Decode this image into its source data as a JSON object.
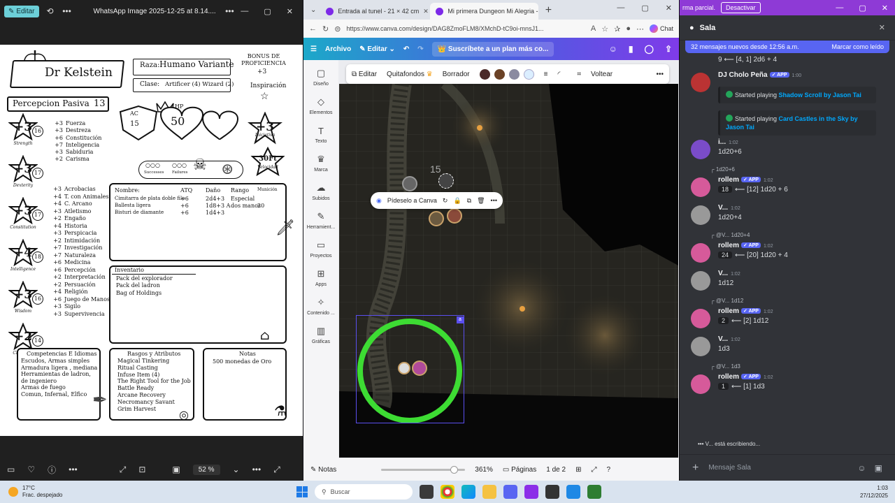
{
  "photos": {
    "edit_label": "Editar",
    "file_title": "WhatsApp Image 2025-12-25 at 8.14....",
    "zoom": "52 %"
  },
  "sheet": {
    "name": "Dr Kelstein",
    "raza_label": "Raza:",
    "raza": "Humano Variante",
    "clase_label": "Clase:",
    "clase": "Artificer (4) Wizard (2)",
    "bonus_label": "BONUS DE PROFICIENCIA",
    "bonus": "+3",
    "inspiracion": "Inspiración",
    "percepcion_label": "Percepcion Pasiva",
    "percepcion": "13",
    "ac_label": "AC",
    "ac": "15",
    "hp_label": "HP",
    "hp": "50",
    "iniciativa": "+3",
    "iniciativa_label": "Iniciativa",
    "velocidad": "30Ft",
    "velocidad_label": "Velocidad",
    "successes": "Successes",
    "failures": "Failures",
    "stats": [
      {
        "mod": "+3",
        "score": "16",
        "label": "Strength"
      },
      {
        "mod": "+3",
        "score": "17",
        "label": "Dexterity"
      },
      {
        "mod": "+3",
        "score": "17",
        "label": "Constitution"
      },
      {
        "mod": "+4",
        "score": "18",
        "label": "Intelligence"
      },
      {
        "mod": "+3",
        "score": "16",
        "label": "Wisdom"
      },
      {
        "mod": "+2",
        "score": "14",
        "label": "Charisma"
      }
    ],
    "saves": [
      {
        "b": "+3",
        "n": "Fuerza"
      },
      {
        "b": "+3",
        "n": "Destreza"
      },
      {
        "b": "+6",
        "n": "Constitución"
      },
      {
        "b": "+7",
        "n": "Inteligencia"
      },
      {
        "b": "+3",
        "n": "Sabiduria"
      },
      {
        "b": "+2",
        "n": "Carisma"
      }
    ],
    "skills": [
      {
        "b": "+3",
        "n": "Acrobacias"
      },
      {
        "b": "+4",
        "n": "T. con Animales"
      },
      {
        "b": "+4",
        "n": "C. Arcano"
      },
      {
        "b": "+3",
        "n": "Atletismo"
      },
      {
        "b": "+2",
        "n": "Engaño"
      },
      {
        "b": "+4",
        "n": "Historia"
      },
      {
        "b": "+3",
        "n": "Perspicacia"
      },
      {
        "b": "+2",
        "n": "Intimidación"
      },
      {
        "b": "+7",
        "n": "Investigación"
      },
      {
        "b": "+7",
        "n": "Naturaleza"
      },
      {
        "b": "+6",
        "n": "Medicina"
      },
      {
        "b": "+6",
        "n": "Percepción"
      },
      {
        "b": "+2",
        "n": "Interpretación"
      },
      {
        "b": "+2",
        "n": "Persuación"
      },
      {
        "b": "+4",
        "n": "Religión"
      },
      {
        "b": "+6",
        "n": "Juego de Manos"
      },
      {
        "b": "+3",
        "n": "Sigilo"
      },
      {
        "b": "+3",
        "n": "Supervivencia"
      }
    ],
    "attacks_headers": [
      "Nombre:",
      "ATQ",
      "Daño",
      "Rango",
      "Munición"
    ],
    "attacks": [
      {
        "n": "Cimitarra de plata doble filo",
        "atq": "+6",
        "dmg": "2d4+3",
        "rng": "Especial",
        "mun": ""
      },
      {
        "n": "Ballesta ligera",
        "atq": "+6",
        "dmg": "1d8+3 A",
        "rng": "dos manos",
        "mun": "20"
      },
      {
        "n": "Bisturi de diamante",
        "atq": "+6",
        "dmg": "1d4+3",
        "rng": "",
        "mun": ""
      }
    ],
    "inventario_label": "Inventario",
    "inventario": [
      "Pack del explorador",
      "Pack del ladron",
      "Bag of Holdings"
    ],
    "comp_title": "Competencias E Idiomas",
    "comp": [
      "Escudos, Armas simples",
      "Armadura ligera , mediana",
      "Herramientas de ladron, de ingeniero",
      "Armas de fuego",
      "Comun, Infernal, Elfico"
    ],
    "rasgos_title": "Rasgos y Atributos",
    "rasgos": [
      "Magical Tinkering",
      "Ritual Casting",
      "Infuse Item (4)",
      "The Right Tool for the Job",
      "Battle Ready",
      "Arcane Recovery",
      "Necromancy Savant",
      "Grim Harvest"
    ],
    "notas_title": "Notas",
    "notas": [
      "500 monedas de Oro"
    ]
  },
  "edge": {
    "tab1": "Entrada al tunel - 21 × 42 cm",
    "tab2": "Mi primera Dungeon Mi Alegria -",
    "url": "https://www.canva.com/design/DAG8ZmoFLM8/XMchD-tC9oi-mnsJ1...",
    "chat": "Chat"
  },
  "canva": {
    "archivo": "Archivo",
    "editar": "Editar",
    "subscribe": "Suscríbete a un plan más co...",
    "sidebar": [
      {
        "label": "Diseño",
        "icon": "▢"
      },
      {
        "label": "Elementos",
        "icon": "◇"
      },
      {
        "label": "Texto",
        "icon": "T"
      },
      {
        "label": "Marca",
        "icon": "♛"
      },
      {
        "label": "Subidos",
        "icon": "☁"
      },
      {
        "label": "Herramient...",
        "icon": "✎"
      },
      {
        "label": "Proyectos",
        "icon": "▭"
      },
      {
        "label": "Apps",
        "icon": "⊞"
      },
      {
        "label": "Contenido ...",
        "icon": "✧"
      },
      {
        "label": "Gráficas",
        "icon": "▥"
      }
    ],
    "ctx": {
      "editar": "Editar",
      "quitafondos": "Quitafondos",
      "borrador": "Borrador",
      "voltear": "Voltear"
    },
    "swatches": [
      "#4a2a2a",
      "#6b4226",
      "#8a8aa0",
      "#dbeeff"
    ],
    "floatbar": "Pídeselo a Canva",
    "notas": "Notas",
    "zoom": "361%",
    "zoom_fraction": 0.82,
    "paginas": "Páginas",
    "page_count": "1 de 2",
    "map_number": "15"
  },
  "discord": {
    "banner_text": "rma parcial.",
    "banner_btn": "Desactivar",
    "room": "Sala",
    "newmsgs": "32 mensajes nuevos desde 12:56 a.m.",
    "mark_read": "Marcar como leído",
    "messages": [
      {
        "kind": "text",
        "text": "9  ⟵ [4, 1] 2d6 + 4"
      },
      {
        "kind": "author",
        "name": "DJ Cholo Peña",
        "app": "APP",
        "ts": "1:00"
      },
      {
        "kind": "embed",
        "prefix": "Started playing ",
        "link": "Shadow Scroll by Jason Tai"
      },
      {
        "kind": "embed",
        "prefix": "Started playing ",
        "link": "Card Castles in the Sky by Jason Tai"
      },
      {
        "kind": "author",
        "name": "i...",
        "ts": "1:02",
        "text": "1d20+6"
      },
      {
        "kind": "reply",
        "text": "1d20+6"
      },
      {
        "kind": "author",
        "name": "rollem",
        "app": "APP",
        "ts": "1:02",
        "num": "18",
        "text": "⟵ [12] 1d20 + 6"
      },
      {
        "kind": "author",
        "name": "V...",
        "ts": "1:02",
        "text": "1d20+4"
      },
      {
        "kind": "reply",
        "text": "@V...  1d20+4"
      },
      {
        "kind": "author",
        "name": "rollem",
        "app": "APP",
        "ts": "1:02",
        "num": "24",
        "text": "⟵ [20] 1d20 + 4"
      },
      {
        "kind": "author",
        "name": "V...",
        "ts": "1:02",
        "text": "1d12"
      },
      {
        "kind": "reply",
        "text": "@V...  1d12"
      },
      {
        "kind": "author",
        "name": "rollem",
        "app": "APP",
        "ts": "1:02",
        "num": "2",
        "text": "⟵ [2] 1d12"
      },
      {
        "kind": "author",
        "name": "V...",
        "ts": "1:02",
        "text": "1d3"
      },
      {
        "kind": "reply",
        "text": "@V...  1d3"
      },
      {
        "kind": "author",
        "name": "rollem",
        "app": "APP",
        "ts": "1:02",
        "num": "1",
        "text": "⟵ [1] 1d3"
      }
    ],
    "typing": "V... está escribiendo...",
    "composer_placeholder": "Mensaje Sala"
  },
  "taskbar": {
    "temp": "17°C",
    "weather": "Frac. despejado",
    "search": "Buscar",
    "time": "1:03",
    "date": "27/12/2025"
  }
}
